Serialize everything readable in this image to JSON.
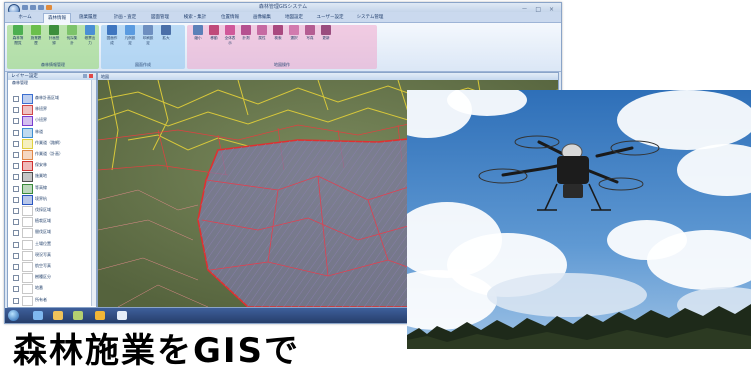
{
  "app": {
    "title": "森林管理GISシステム",
    "window_controls": "－ □ ×"
  },
  "ribbon_tabs": [
    {
      "label": "ホーム"
    },
    {
      "label": "森林情報"
    },
    {
      "label": "施業履歴"
    },
    {
      "label": "計画・査定"
    },
    {
      "label": "図面管理"
    },
    {
      "label": "検索・集計"
    },
    {
      "label": "位置情報"
    },
    {
      "label": "画像編集"
    },
    {
      "label": "地図設定"
    },
    {
      "label": "ユーザー設定"
    },
    {
      "label": "システム管理"
    }
  ],
  "ribbon_groups": [
    {
      "label": "森林情報管理"
    },
    {
      "label": "図面作成"
    },
    {
      "label": "地図操作"
    }
  ],
  "ribbon_buttons": [
    {
      "label": "森林簿閲覧",
      "color": "#4caf50"
    },
    {
      "label": "施業履歴",
      "color": "#6bbf4c"
    },
    {
      "label": "計画登録",
      "color": "#3d8f3d"
    },
    {
      "label": "伐採集計",
      "color": "#7cc36a"
    },
    {
      "label": "帳票出力",
      "color": "#4a8fd4"
    },
    {
      "label": "図面作成",
      "color": "#3f76c0"
    },
    {
      "label": "凡例設定",
      "color": "#5a9be0"
    },
    {
      "label": "印刷設定",
      "color": "#6d8fc0"
    },
    {
      "label": "拡大",
      "color": "#4a6fa8"
    },
    {
      "label": "縮小",
      "color": "#5b80b8"
    },
    {
      "label": "移動",
      "color": "#c04a7a"
    },
    {
      "label": "全体表示",
      "color": "#d0589a"
    },
    {
      "label": "計測",
      "color": "#b55090"
    },
    {
      "label": "属性",
      "color": "#c66aa2"
    },
    {
      "label": "検索",
      "color": "#a9497f"
    },
    {
      "label": "選択",
      "color": "#d27aae"
    },
    {
      "label": "写真",
      "color": "#b45d92"
    },
    {
      "label": "更新",
      "color": "#9a4d7f"
    }
  ],
  "left_panel": {
    "title": "レイヤー設定",
    "root": "森林管理",
    "layers": [
      {
        "label": "森林計画区域",
        "color": "#3c6fd0"
      },
      {
        "label": "林班界",
        "color": "#d04848"
      },
      {
        "label": "小班界",
        "color": "#7a3fd0"
      },
      {
        "label": "林道",
        "color": "#3f8fd0"
      },
      {
        "label": "作業道（路網）",
        "color": "#e0d040"
      },
      {
        "label": "作業道（計画）",
        "color": "#e08848"
      },
      {
        "label": "保安林",
        "color": "#d03030"
      },
      {
        "label": "施業地",
        "color": "#505050"
      },
      {
        "label": "等高線",
        "color": "#3a8a3a"
      },
      {
        "label": "境界杭",
        "color": "#2a56c0"
      },
      {
        "label": "伐採区域",
        "color": "#c8c8c8"
      },
      {
        "label": "植栽区域",
        "color": "#c8c8c8"
      },
      {
        "label": "間伐区域",
        "color": "#c8c8c8"
      },
      {
        "label": "土場位置",
        "color": "#c8c8c8"
      },
      {
        "label": "現況写真",
        "color": "#c8c8c8"
      },
      {
        "label": "航空写真",
        "color": "#c8c8c8"
      },
      {
        "label": "樹種区分",
        "color": "#c8c8c8"
      },
      {
        "label": "地番",
        "color": "#c8c8c8"
      },
      {
        "label": "所有者",
        "color": "#c8c8c8"
      }
    ]
  },
  "map": {
    "title": "地図"
  },
  "caption": "森林施業をGISで"
}
